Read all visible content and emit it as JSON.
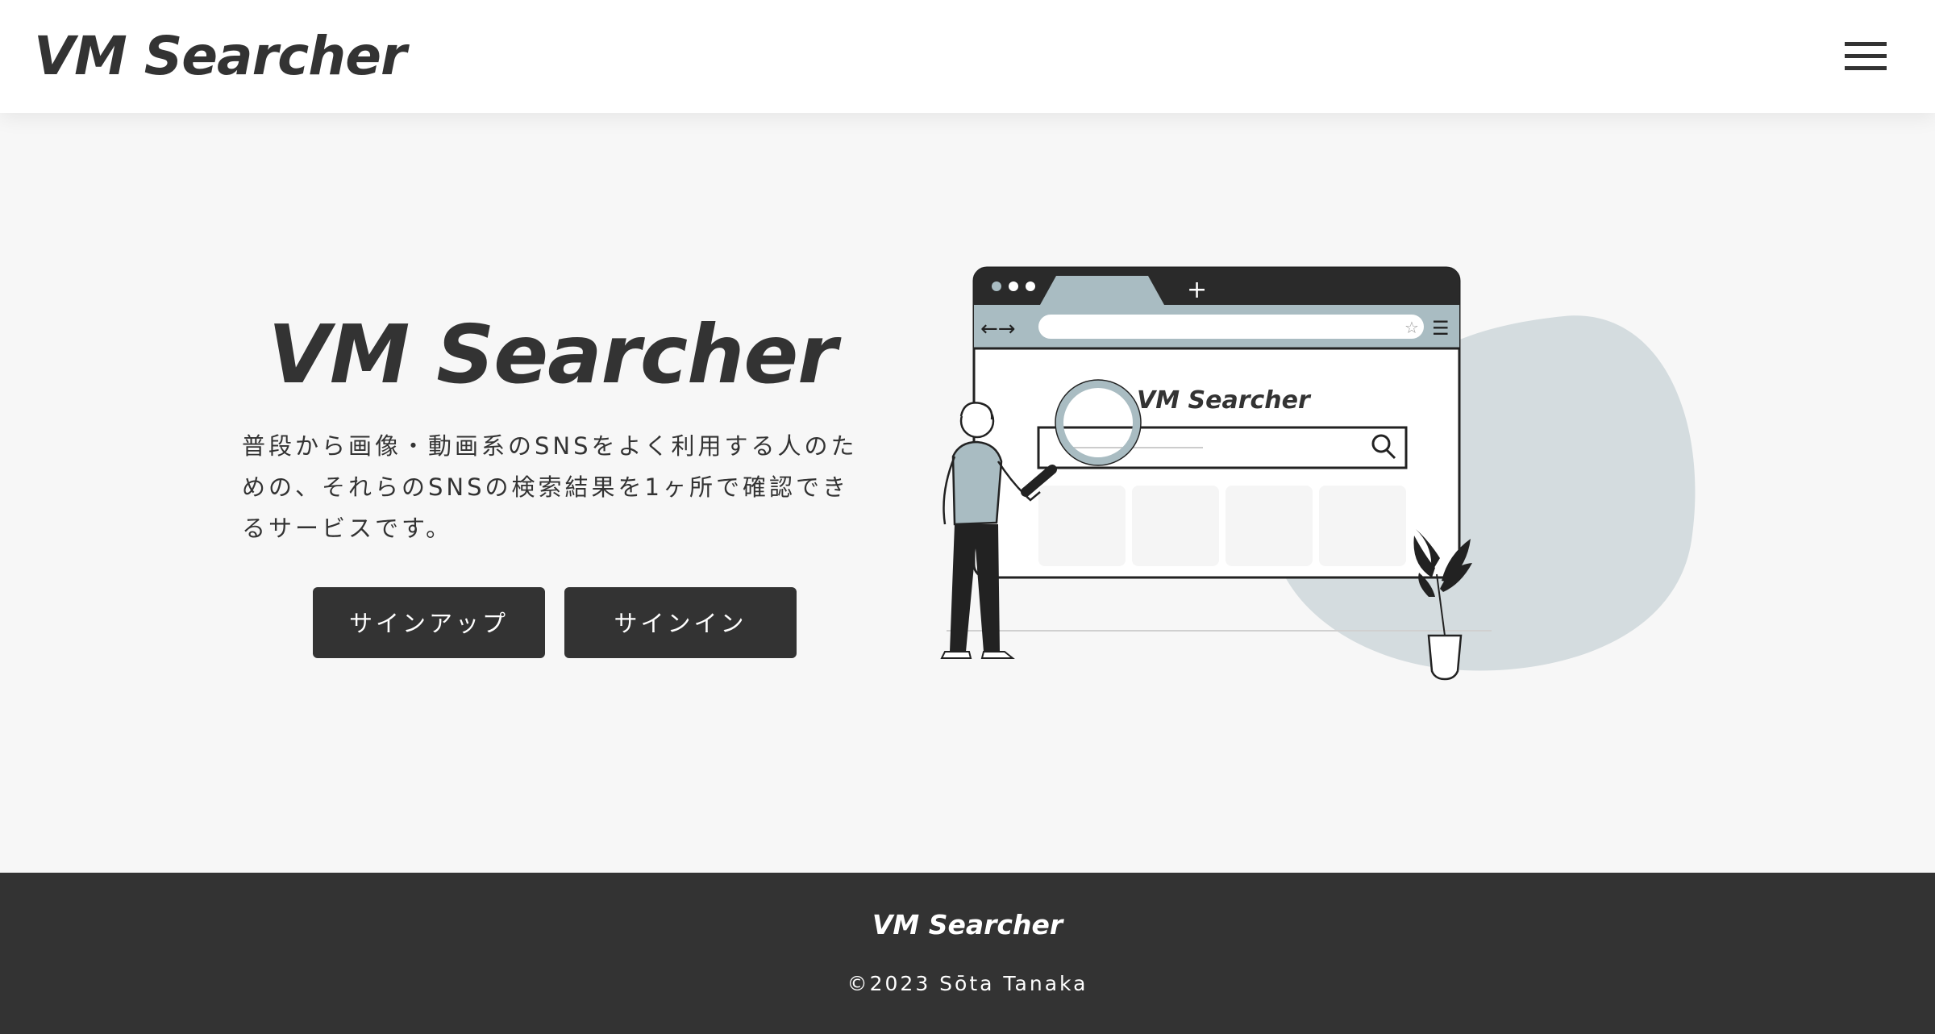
{
  "header": {
    "logo": "VM Searcher",
    "menu_icon": "hamburger-menu-icon"
  },
  "hero": {
    "title": "VM Searcher",
    "description": "普段から画像・動画系のSNSをよく利用する人のための、それらのSNSの検索結果を1ヶ所で確認できるサービスです。",
    "signup_label": "サインアップ",
    "signin_label": "サインイン"
  },
  "illustration": {
    "browser_title": "VM Searcher",
    "new_tab_symbol": "+",
    "back_forward": "←→",
    "icons": [
      "star-icon",
      "menu-icon",
      "search-icon",
      "magnifying-glass-icon",
      "person-icon",
      "plant-icon"
    ]
  },
  "footer": {
    "logo": "VM Searcher",
    "copyright": "©2023 Sōta Tanaka"
  },
  "colors": {
    "dark": "#333333",
    "background": "#f7f7f7",
    "accent_blue_gray": "#a9bcc2",
    "blob": "#d4dcdf"
  }
}
